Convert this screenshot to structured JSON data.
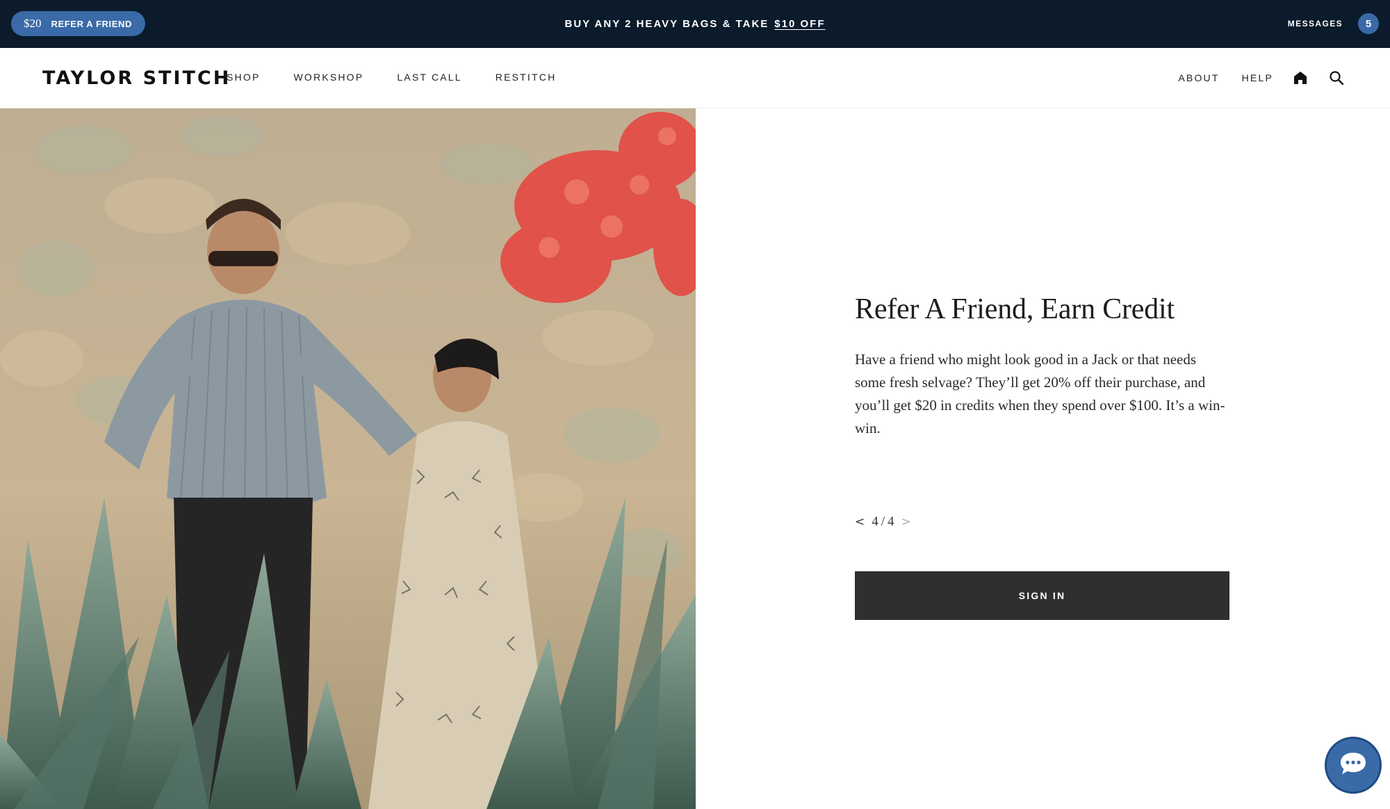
{
  "promo_bar": {
    "refer_amount": "$20",
    "refer_label": "REFER A FRIEND",
    "promo_text": "BUY ANY 2 HEAVY BAGS & TAKE",
    "promo_link": "$10 OFF",
    "messages_label": "MESSAGES",
    "messages_count": "5"
  },
  "nav": {
    "logo": "TAYLOR STITCH",
    "left_links": [
      "SHOP",
      "WORKSHOP",
      "LAST CALL",
      "RESTITCH"
    ],
    "right_links": [
      "ABOUT",
      "HELP"
    ],
    "icons": [
      "home-icon",
      "search-icon"
    ]
  },
  "hero": {
    "headline": "Refer A Friend, Earn Credit",
    "body": "Have a friend who might look good in a Jack or that needs some fresh selvage? They’ll get 20% off their purchase, and you’ll get $20 in credits when they spend over $100. It’s a win-win.",
    "pager": {
      "prev": "<",
      "current": "4",
      "separator": "/",
      "total": "4",
      "next": ">"
    },
    "sign_in_label": "SIGN IN"
  },
  "chat": {
    "icon": "chat-icon"
  },
  "colors": {
    "promo_bg": "#0b1b2b",
    "accent_blue": "#3a6aa7",
    "button_dark": "#2f2f31"
  }
}
